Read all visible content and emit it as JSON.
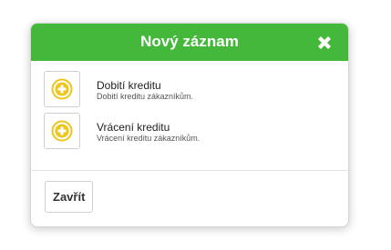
{
  "dialog": {
    "title": "Nový záznam",
    "close_icon": "close-x-icon",
    "header_color": "#43b83a",
    "accent_icon_color": "#f0c419"
  },
  "items": [
    {
      "icon": "plus-circle-icon",
      "title": "Dobití kreditu",
      "description": "Dobití kreditu zákazníkům."
    },
    {
      "icon": "plus-circle-icon",
      "title": "Vrácení kreditu",
      "description": "Vrácení kreditu zákazníkům."
    }
  ],
  "footer": {
    "close_label": "Zavřít"
  }
}
